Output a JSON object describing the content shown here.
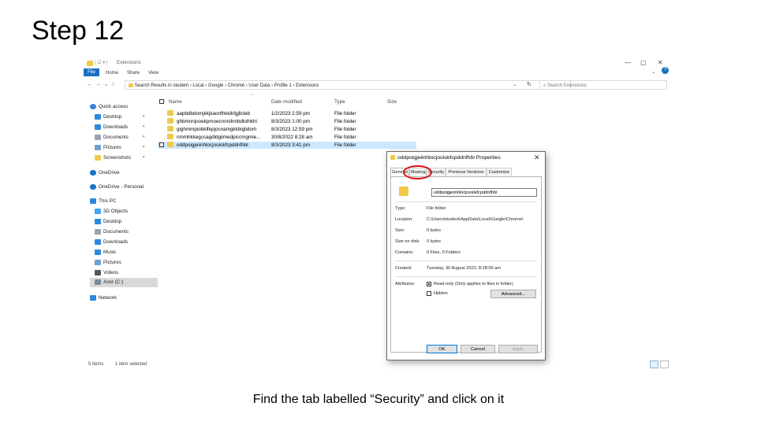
{
  "slide": {
    "title": "Step 12",
    "caption": "Find the tab labelled “Security” and click on it"
  },
  "explorer": {
    "window_title": "Extensions",
    "window_controls": [
      "—",
      "▢",
      "✕"
    ],
    "ribbon_tabs": [
      "File",
      "Home",
      "Share",
      "View"
    ],
    "address_parts": "Search Results in student  ›  Local  ›  Google  ›  Chrome  ›  User Data  ›  Profile 1  ›  Extensions",
    "search_placeholder": "Search Extensions",
    "columns": {
      "name": "Name",
      "date": "Date modified",
      "type": "Type",
      "size": "Size"
    },
    "files": [
      {
        "name": "aapbdbdomjkkjkaonfhkkikfgjllcleb",
        "date": "1/2/2023 2:59 pm",
        "type": "File folder"
      },
      {
        "name": "ghbmnnjooekpmoecnnnilnnbdlolhkhi",
        "date": "8/3/2023 1:00 pm",
        "type": "File folder"
      },
      {
        "name": "gighmmpiobklfepjocnamgkkbiglidom",
        "date": "8/3/2023 12:59 pm",
        "type": "File folder"
      },
      {
        "name": "nmmhkkegccagdldgiimedpiccmgmie...",
        "date": "30/8/2022 8:28 am",
        "type": "File folder"
      },
      {
        "name": "oddpoigjeiinhlocjooiokfcpddnfhbl",
        "date": "8/3/2023 3:41 pm",
        "type": "File folder"
      }
    ],
    "sidebar": [
      {
        "label": "Quick access",
        "icon": "star-icon",
        "color": "#3b82d6"
      },
      {
        "label": "Desktop",
        "icon": "desktop-icon",
        "color": "#2a8ae0",
        "pinned": true
      },
      {
        "label": "Downloads",
        "icon": "download-icon",
        "color": "#2a8ae0",
        "pinned": true
      },
      {
        "label": "Documents",
        "icon": "documents-icon",
        "color": "#9aa4b0",
        "pinned": true
      },
      {
        "label": "Pictures",
        "icon": "pictures-icon",
        "color": "#6fa2cf",
        "pinned": true
      },
      {
        "label": "Screenshots",
        "icon": "folder-icon",
        "color": "#f0c94a",
        "pinned": true
      },
      {
        "label": "OneDrive",
        "icon": "cloud-icon",
        "color": "#1a73c8"
      },
      {
        "label": "OneDrive - Personal",
        "icon": "cloud-icon",
        "color": "#1a73c8"
      },
      {
        "label": "This PC",
        "icon": "pc-icon",
        "color": "#2a8ae0"
      },
      {
        "label": "3D Objects",
        "icon": "cube-icon",
        "color": "#42a5f5"
      },
      {
        "label": "Desktop",
        "icon": "desktop-icon",
        "color": "#2a8ae0"
      },
      {
        "label": "Documents",
        "icon": "documents-icon",
        "color": "#9aa4b0"
      },
      {
        "label": "Downloads",
        "icon": "download-icon",
        "color": "#2a8ae0"
      },
      {
        "label": "Music",
        "icon": "music-icon",
        "color": "#2a8ae0"
      },
      {
        "label": "Pictures",
        "icon": "pictures-icon",
        "color": "#6fa2cf"
      },
      {
        "label": "Videos",
        "icon": "videos-icon",
        "color": "#555"
      },
      {
        "label": "Acer (C:)",
        "icon": "drive-icon",
        "color": "#7a8a99"
      },
      {
        "label": "Network",
        "icon": "network-icon",
        "color": "#2a8ae0"
      }
    ],
    "status_items": "5 items",
    "status_selected": "1 item selected"
  },
  "dialog": {
    "title": "oddpoigjeiinhlocjooiokfcpddnfhbl Properties",
    "tabs": [
      "General",
      "Sharing",
      "Security",
      "Previous Versions",
      "Customize"
    ],
    "active_tab": "General",
    "folder_name": "oddpoigjeiinhlocjooiokfcpddnfhbl",
    "fields": [
      {
        "label": "Type:",
        "value": "File folder"
      },
      {
        "label": "Location:",
        "value": "C:\\Users\\student\\AppData\\Local\\Google\\Chrome\\"
      },
      {
        "label": "Size:",
        "value": "0 bytes"
      },
      {
        "label": "Size on disk:",
        "value": "0 bytes"
      },
      {
        "label": "Contains:",
        "value": "0 Files, 0 Folders"
      },
      {
        "label": "Created:",
        "value": "Tuesday, 30 August 2022, 8:28:00 am"
      }
    ],
    "attributes_label": "Attributes:",
    "readonly_label": "Read-only (Only applies to files in folder)",
    "hidden_label": "Hidden",
    "advanced_label": "Advanced...",
    "ok_label": "OK",
    "cancel_label": "Cancel",
    "apply_label": "Apply",
    "highlight_color": "#e01010"
  }
}
